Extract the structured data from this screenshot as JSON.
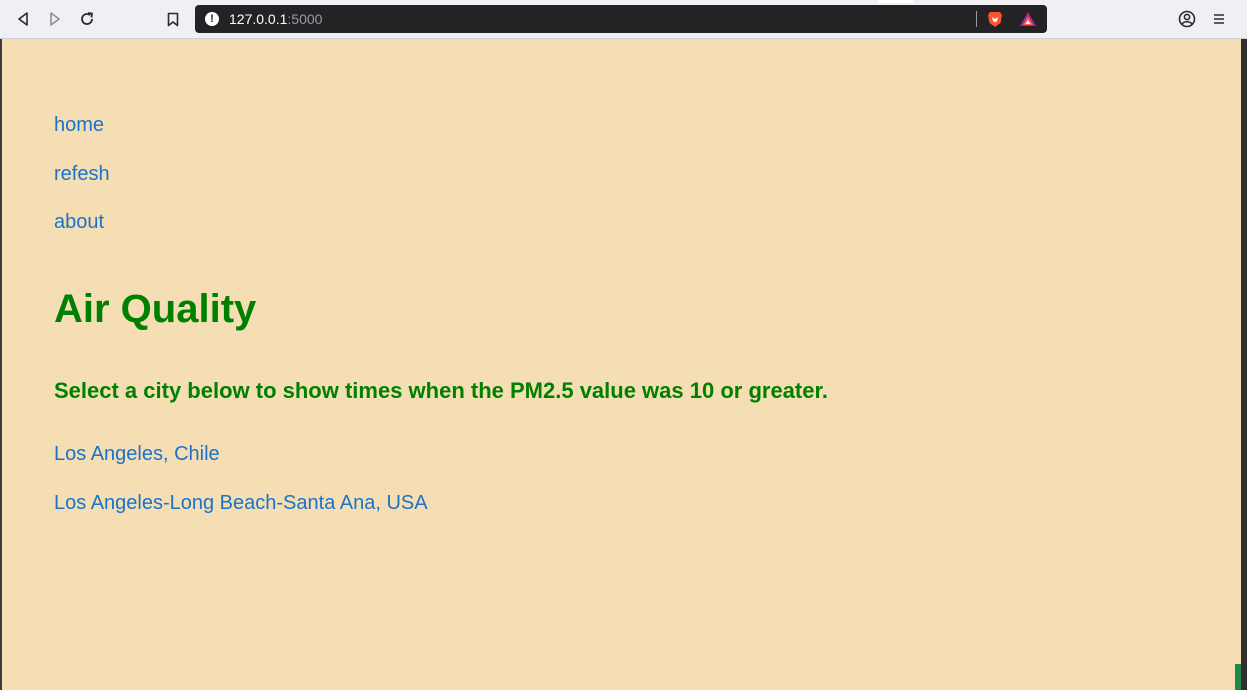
{
  "browser": {
    "url_host": "127.0.0.1",
    "url_port": ":5000",
    "info_glyph": "!"
  },
  "nav": {
    "items": [
      {
        "label": "home"
      },
      {
        "label": "refesh"
      },
      {
        "label": "about"
      }
    ]
  },
  "main": {
    "title": "Air Quality",
    "subtitle": "Select a city below to show times when the PM2.5 value was 10 or greater.",
    "cities": [
      {
        "label": "Los Angeles, Chile"
      },
      {
        "label": "Los Angeles-Long Beach-Santa Ana, USA"
      }
    ]
  },
  "colors": {
    "page_background": "#f5deb3",
    "heading_green": "#008000",
    "link_blue": "#1a73c8",
    "urlbar_dark": "#232326"
  },
  "icons": [
    "back-icon",
    "forward-icon",
    "reload-icon",
    "bookmark-icon",
    "site-info-icon",
    "brave-shields-icon",
    "brave-rewards-icon",
    "account-icon",
    "menu-icon"
  ]
}
